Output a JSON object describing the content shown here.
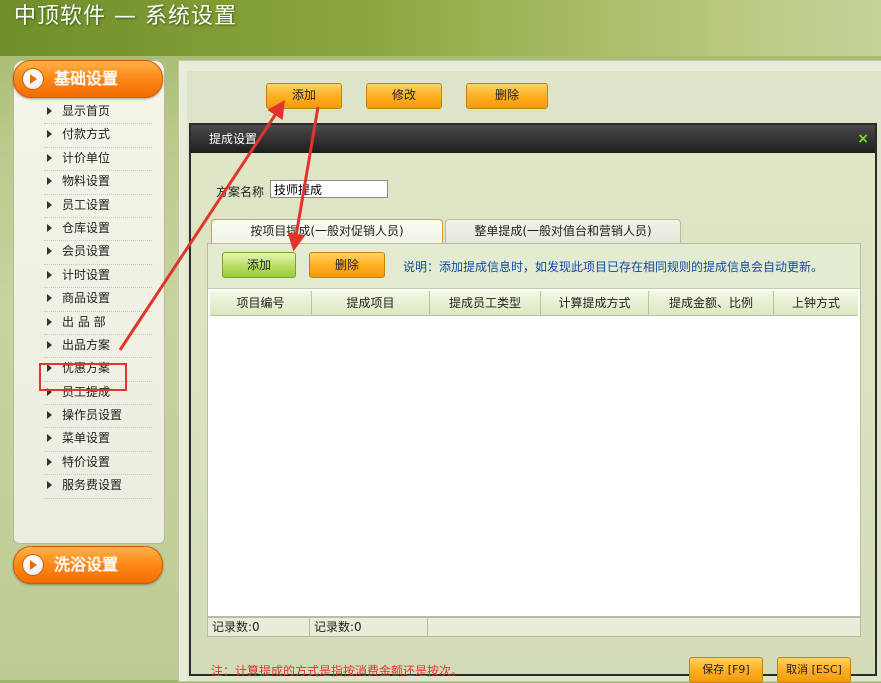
{
  "app": {
    "title": "中顶软件 — 系统设置"
  },
  "sidebar": {
    "section_basic": "基础设置",
    "section_bath": "洗浴设置",
    "items": [
      "显示首页",
      "付款方式",
      "计价单位",
      "物料设置",
      "员工设置",
      "仓库设置",
      "会员设置",
      "计时设置",
      "商品设置",
      "出 品 部",
      "出品方案",
      "优惠方案",
      "员工提成",
      "操作员设置",
      "菜单设置",
      "特价设置",
      "服务费设置"
    ]
  },
  "main_toolbar": {
    "add": "添加",
    "edit": "修改",
    "delete": "删除"
  },
  "dialog": {
    "title": "提成设置",
    "close": "×",
    "scheme_label": "方案名称",
    "scheme_value": "技师提成",
    "tabs": [
      "按项目提成(一般对促销人员)",
      "整单提成(一般对值台和营销人员)"
    ],
    "toolbar": {
      "add": "添加",
      "delete": "删除"
    },
    "hint": "说明：添加提成信息时，如发现此项目已存在相同规则的提成信息会自动更新。",
    "columns": [
      "项目编号",
      "提成项目",
      "提成员工类型",
      "计算提成方式",
      "提成金额、比例",
      "上钟方式"
    ],
    "status": [
      "记录数:0",
      "记录数:0"
    ],
    "note": "注：计算提成的方式是指按消费金额还是按次。",
    "save": "保存 [F9]",
    "cancel": "取消 [ESC]"
  },
  "colors": {
    "orange_button": "#ffb020",
    "green_button": "#b8dd62",
    "annotation_red": "#e0342d",
    "titlebar": "#1e1e1e"
  }
}
